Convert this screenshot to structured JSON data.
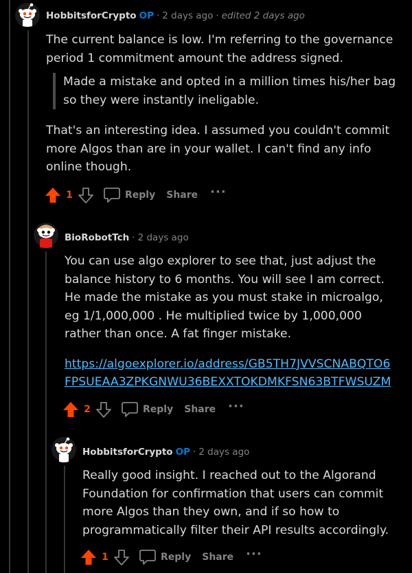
{
  "colors": {
    "background": "#000000",
    "text": "#d7dadc",
    "meta": "#818384",
    "op_badge": "#0079d3",
    "upvote": "#ff4500",
    "link": "#4fbcff",
    "thread_line": "#343536"
  },
  "comments": [
    {
      "author": "HobbitsforCrypto",
      "op_badge": "OP",
      "sep1": "·",
      "time": "2 days ago",
      "sep2": "·",
      "edited": "edited 2 days ago",
      "paragraph1": "The current balance is low. I'm referring to the governance period 1 commitment amount the address signed.",
      "quote": "Made a mistake and opted in a million times his/her bag so they were instantly ineligable.",
      "paragraph2": "That's an interesting idea. I assumed you couldn't commit more Algos than are in your wallet. I can't find any info online though.",
      "score": "1",
      "reply_label": "Reply",
      "share_label": "Share",
      "more_label": "···",
      "avatar_icon": "snoo-avatar-icon"
    },
    {
      "author": "BioRobotTch",
      "sep1": "·",
      "time": "2 days ago",
      "paragraph1": "You can use algo explorer to see that, just adjust the balance history to 6 months. You will see I am correct. He made the mistake as you must stake in microalgo, eg 1/1,000,000 . He multiplied twice by 1,000,000 rather than once. A fat finger mistake.",
      "link": "https://algoexplorer.io/address/GB5TH7JVVSCNABQTO6FPSUEAA3ZPKGNWU36BEXXTOKDMKFSN63BTFWSUZM",
      "score": "2",
      "reply_label": "Reply",
      "share_label": "Share",
      "more_label": "···",
      "avatar_icon": "snoo-avatar-icon"
    },
    {
      "author": "HobbitsforCrypto",
      "op_badge": "OP",
      "sep1": "·",
      "time": "2 days ago",
      "paragraph1": "Really good insight. I reached out to the Algorand Foundation for confirmation that users can commit more Algos than they own, and if so how to programmatically filter their API results accordingly.",
      "score": "1",
      "reply_label": "Reply",
      "share_label": "Share",
      "more_label": "···",
      "avatar_icon": "snoo-avatar-icon"
    }
  ]
}
